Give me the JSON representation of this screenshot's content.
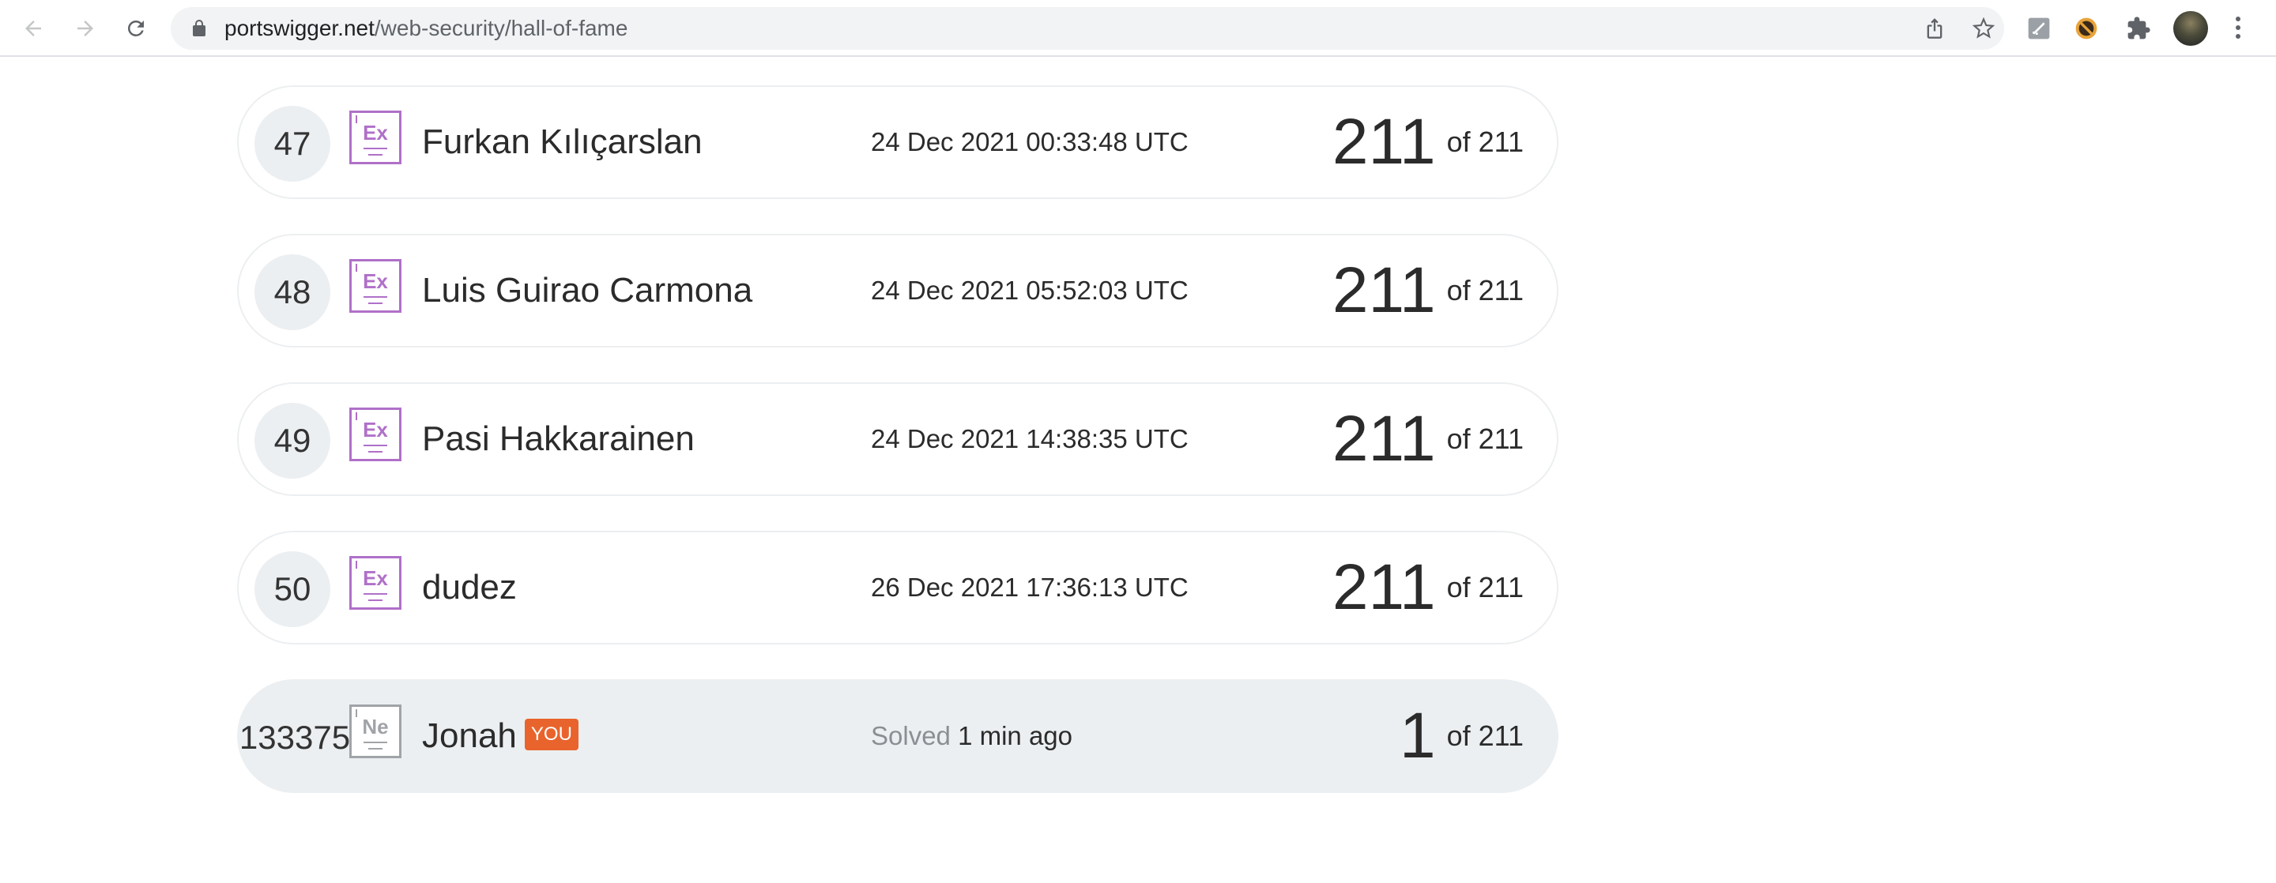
{
  "browser": {
    "url_host": "portswigger.net",
    "url_path": "/web-security/hall-of-fame"
  },
  "colors": {
    "expert_badge": "#b070c8",
    "novice_badge": "#a0a4a8",
    "you_tag": "#e8642c",
    "row_highlight": "#eceff1"
  },
  "leaderboard": {
    "rows": [
      {
        "rank": "47",
        "badge": "Ex",
        "name": "Furkan Kılıçarslan",
        "date": "24 Dec 2021 00:33:48 UTC",
        "score": "211",
        "of": "of 211"
      },
      {
        "rank": "48",
        "badge": "Ex",
        "name": "Luis Guirao Carmona",
        "date": "24 Dec 2021 05:52:03 UTC",
        "score": "211",
        "of": "of 211"
      },
      {
        "rank": "49",
        "badge": "Ex",
        "name": "Pasi Hakkarainen",
        "date": "24 Dec 2021 14:38:35 UTC",
        "score": "211",
        "of": "of 211"
      },
      {
        "rank": "50",
        "badge": "Ex",
        "name": "dudez",
        "date": "26 Dec 2021 17:36:13 UTC",
        "score": "211",
        "of": "of 211"
      }
    ],
    "you": {
      "rank": "133375",
      "badge": "Ne",
      "name": "Jonah",
      "tag": "YOU",
      "solved_label": "Solved",
      "solved_time": "1 min ago",
      "score": "1",
      "of": "of 211"
    }
  }
}
